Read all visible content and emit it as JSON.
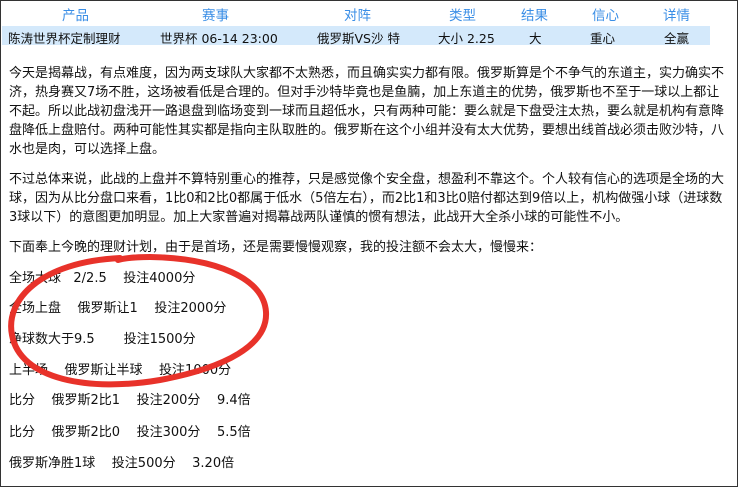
{
  "table": {
    "headers": [
      "产品",
      "赛事",
      "对阵",
      "类型",
      "结果",
      "信心",
      "详情"
    ],
    "row": [
      "陈涛世界杯定制理财",
      "世界杯 06-14 23:00",
      "俄罗斯VS沙 特",
      "大小 2.25",
      "大",
      "重心",
      "全赢"
    ]
  },
  "article": {
    "paragraphs": [
      "今天是揭幕战，有点难度，因为两支球队大家都不太熟悉，而且确实实力都有限。俄罗斯算是个不争气的东道主，实力确实不济，热身赛又7场不胜，这场被看低是合理的。但对手沙特毕竟也是鱼腩，加上东道主的优势，俄罗斯也不至于一球以上都让不起。所以此战初盘浅开一路退盘到临场变到一球而且超低水，只有两种可能：要么就是下盘受注太热，要么就是机构有意降盘降低上盘赔付。两种可能性其实都是指向主队取胜的。俄罗斯在这个小组并没有太大优势，要想出线首战必须击败沙特，八水也是肉，可以选择上盘。",
      "不过总体来说，此战的上盘并不算特别重心的推荐，只是感觉像个安全盘，想盈利不靠这个。个人较有信心的选项是全场的大球，因为从比分盘口来看，1比0和2比0都属于低水（5倍左右），而2比1和3比0赔付都达到9倍以上，机构做强小球（进球数3球以下）的意图更加明显。加上大家普遍对揭幕战两队谨慎的惯有想法，此战开大全杀小球的可能性不小。",
      "下面奉上今晚的理财计划，由于是首场，还是需要慢慢观察，我的投注额不会太大，慢慢来："
    ],
    "plan": [
      "全场大球   2/2.5    投注4000分",
      "全场上盘    俄罗斯让1    投注2000分",
      "净球数大于9.5       投注1500分",
      "上半场    俄罗斯让半球    投注1000分",
      "比分    俄罗斯2比1    投注200分    9.4倍",
      "比分    俄罗斯2比0    投注300分    5.5倍",
      "俄罗斯净胜1球    投注500分    3.20倍"
    ]
  },
  "annotation": {
    "color": "#e8322a"
  }
}
